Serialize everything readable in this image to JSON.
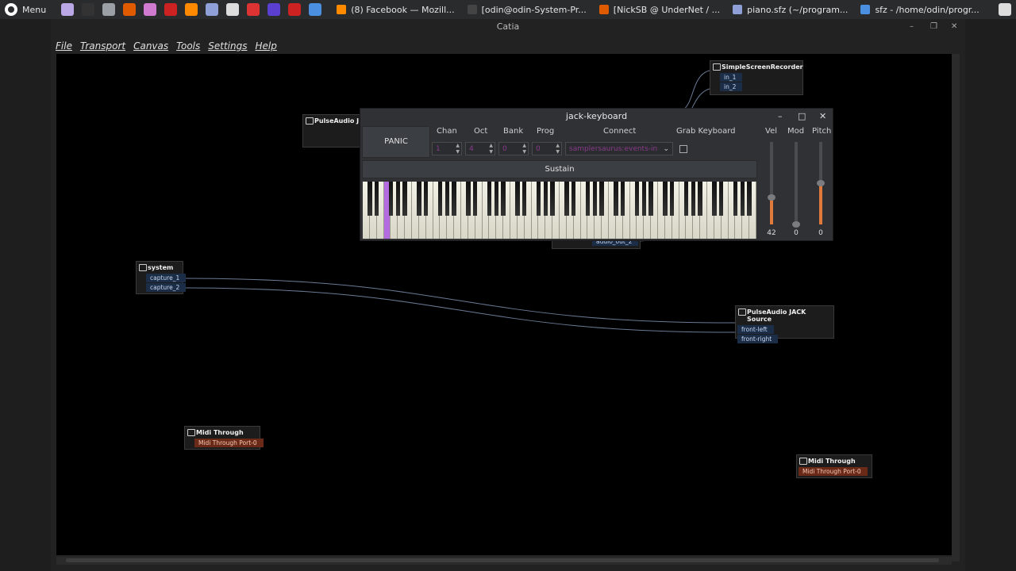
{
  "taskbar": {
    "menu_label": "Menu",
    "launchers": [
      {
        "icon": "files-icon",
        "color": "#b9a7e6"
      },
      {
        "icon": "terminal-icon",
        "color": "#333333"
      },
      {
        "icon": "settings-icon",
        "color": "#9aa0a6"
      },
      {
        "icon": "audacity-icon",
        "color": "#e05a00"
      },
      {
        "icon": "app-icon",
        "color": "#d07bd0"
      },
      {
        "icon": "ardour-icon",
        "color": "#cc2222"
      },
      {
        "icon": "firefox-icon",
        "color": "#ff8a00"
      },
      {
        "icon": "notes-icon",
        "color": "#8fa0d8"
      },
      {
        "icon": "keyboard-icon",
        "color": "#dddddd"
      },
      {
        "icon": "jack-icon",
        "color": "#d33"
      },
      {
        "icon": "player-icon",
        "color": "#5a3fd1"
      },
      {
        "icon": "pdf-icon",
        "color": "#cc2222"
      },
      {
        "icon": "camera-icon",
        "color": "#4a8fe0"
      }
    ],
    "tasks": [
      {
        "icon": "firefox-task-icon",
        "label": "(8) Facebook — Mozill...",
        "color": "#ff8a00"
      },
      {
        "icon": "terminal-task-icon",
        "label": "[odin@odin-System-Pr...",
        "color": "#444444"
      },
      {
        "icon": "irc-task-icon",
        "label": "[NickSB @ UnderNet / ...",
        "color": "#e05a00"
      },
      {
        "icon": "editor-task-icon",
        "label": "piano.sfz (~/program...",
        "color": "#8fa0d8"
      },
      {
        "icon": "folder-task-icon",
        "label": "sfz - /home/odin/progr...",
        "color": "#4a8fe0"
      }
    ]
  },
  "window": {
    "title": "Catia",
    "menu": [
      "File",
      "Transport",
      "Canvas",
      "Tools",
      "Settings",
      "Help"
    ]
  },
  "canvas": {
    "boxes": [
      {
        "title": "SimpleScreenRecorder",
        "ports": [
          "in_1",
          "in_2"
        ],
        "type": "audio"
      },
      {
        "title": "PulseAudio J",
        "ports": [],
        "type": "audio"
      },
      {
        "title": "system",
        "ports": [
          "capture_1",
          "capture_2"
        ],
        "type": "audio"
      },
      {
        "title": "PulseAudio JACK Source",
        "ports": [
          "front-left",
          "front-right"
        ],
        "type": "audio"
      },
      {
        "title": "Midi Through",
        "ports": [
          "Midi Through Port-0"
        ],
        "type": "midi"
      },
      {
        "title": "Midi Through",
        "ports": [
          "Midi Through Port-0"
        ],
        "type": "midi"
      }
    ],
    "partial_port": "audio_out_2"
  },
  "jack_keyboard": {
    "title": "jack-keyboard",
    "panic_label": "PANIC",
    "labels": {
      "chan": "Chan",
      "oct": "Oct",
      "bank": "Bank",
      "prog": "Prog",
      "connect": "Connect",
      "grab": "Grab Keyboard",
      "vel": "Vel",
      "mod": "Mod",
      "pitch": "Pitch"
    },
    "values": {
      "chan": "1",
      "oct": "4",
      "bank": "0",
      "prog": "0",
      "connect": "samplersaurus:events-in"
    },
    "sustain_label": "Sustain",
    "vel": "42",
    "mod": "0",
    "pitch": "0",
    "vel_level": 0.33,
    "mod_level": 0.0,
    "pitch_level": 0.5,
    "accent": "#e07a3a"
  }
}
